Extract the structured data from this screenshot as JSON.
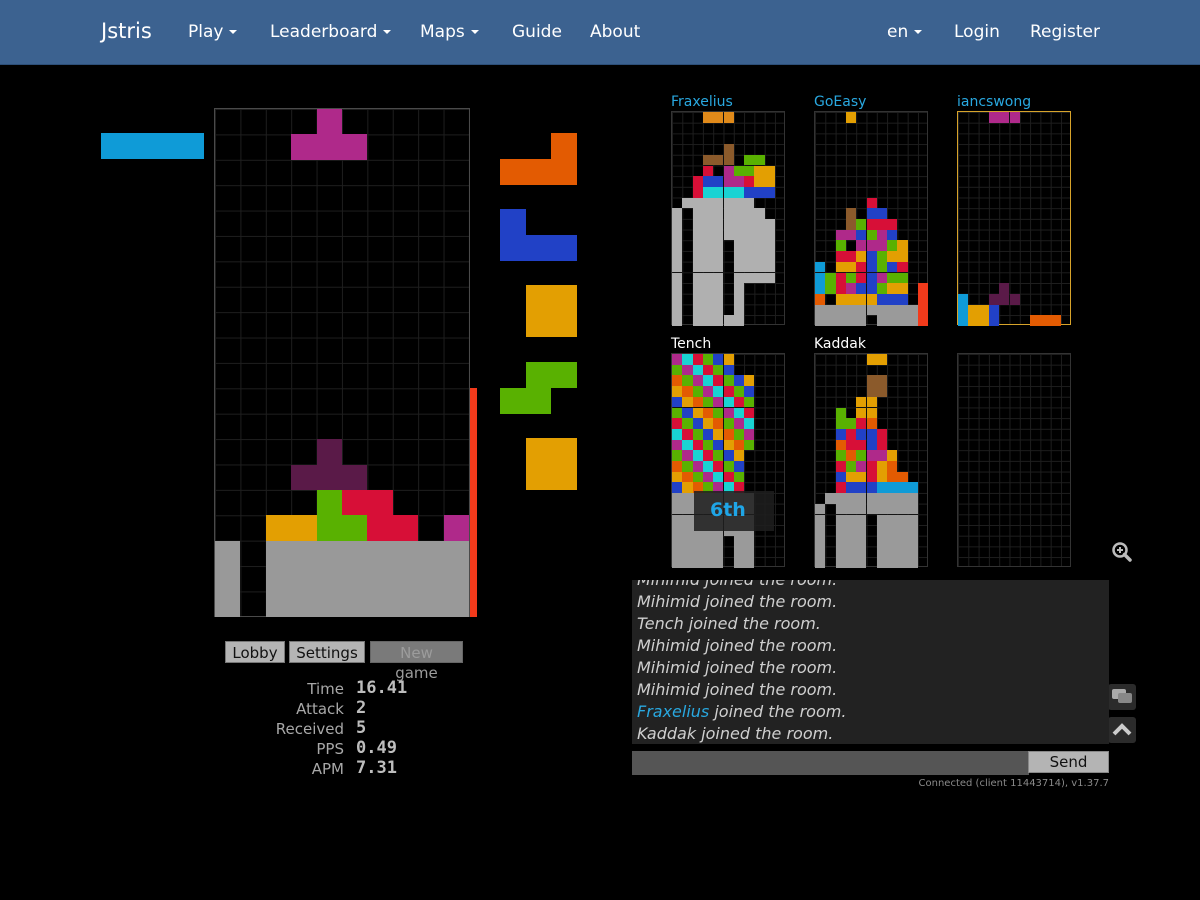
{
  "navbar": {
    "brand": "Jstris",
    "items": [
      "Play",
      "Leaderboard",
      "Maps",
      "Guide",
      "About"
    ],
    "lang": "en",
    "login": "Login",
    "register": "Register"
  },
  "buttons": {
    "lobby": "Lobby",
    "settings": "Settings",
    "new_game": "New game"
  },
  "stats": [
    {
      "label": "Time",
      "value": "16.41"
    },
    {
      "label": "Attack",
      "value": "2"
    },
    {
      "label": "Received",
      "value": "5"
    },
    {
      "label": "PPS",
      "value": "0.49"
    },
    {
      "label": "APM",
      "value": "7.31"
    }
  ],
  "opponents": [
    {
      "name": "Fraxelius",
      "name_color": "#29a8e0"
    },
    {
      "name": "GoEasy",
      "name_color": "#29a8e0"
    },
    {
      "name": "iancswong",
      "name_color": "#29a8e0"
    },
    {
      "name": "Tench",
      "name_color": "#ffffff",
      "place": "6th"
    },
    {
      "name": "Kaddak",
      "name_color": "#ffffff"
    },
    {
      "name": "",
      "name_color": "#ffffff"
    }
  ],
  "chat": {
    "lines": [
      {
        "user": "Mihimid",
        "text": " joined the room.",
        "highlight": false
      },
      {
        "user": "Mihimid",
        "text": " joined the room.",
        "highlight": false
      },
      {
        "user": "Tench",
        "text": " joined the room.",
        "highlight": false
      },
      {
        "user": "Mihimid",
        "text": " joined the room.",
        "highlight": false
      },
      {
        "user": "Mihimid",
        "text": " joined the room.",
        "highlight": false
      },
      {
        "user": "Mihimid",
        "text": " joined the room.",
        "highlight": false
      },
      {
        "user": "Fraxelius",
        "text": " joined the room.",
        "highlight": true
      },
      {
        "user": "Kaddak",
        "text": " joined the room.",
        "highlight": false
      }
    ],
    "send_label": "Send",
    "status": "Connected (client 11443714), v1.37.7"
  },
  "icons": {
    "zoom": "magnifier-plus-icon",
    "chat": "chat-bubbles-icon",
    "up": "chevron-up-icon"
  },
  "colors": {
    "navbar": "#3c6290",
    "I": "#0f9bd7",
    "O": "#e39f02",
    "T": "#af298a",
    "S": "#59b101",
    "Z": "#d70f37",
    "J": "#2141c6",
    "L": "#e35b02",
    "garbage": "#999999"
  },
  "hold_piece": "I",
  "queue": [
    "L",
    "J",
    "O",
    "S",
    "O"
  ],
  "attack_meter_level": 0.45
}
